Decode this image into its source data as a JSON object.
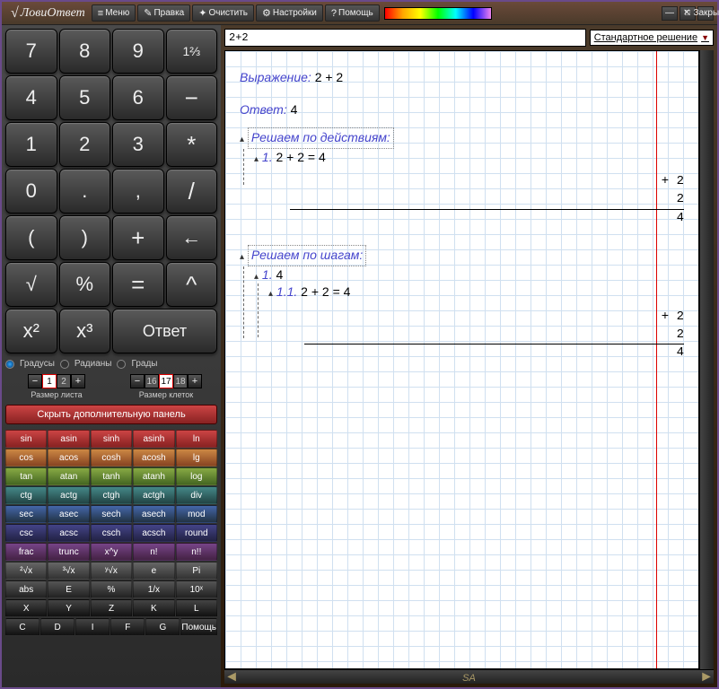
{
  "app": {
    "logo_text": "ЛовиОтвет"
  },
  "menu": {
    "items": [
      {
        "icon": "≡",
        "label": "Меню"
      },
      {
        "icon": "✎",
        "label": "Правка"
      },
      {
        "icon": "✦",
        "label": "Очистить"
      },
      {
        "icon": "⚙",
        "label": "Настройки"
      },
      {
        "icon": "?",
        "label": "Помощь"
      }
    ]
  },
  "window": {
    "close_label": "Закрыть"
  },
  "keypad": {
    "k7": "7",
    "k8": "8",
    "k9": "9",
    "kfrac": "1⅔",
    "k4": "4",
    "k5": "5",
    "k6": "6",
    "kminus": "−",
    "k1": "1",
    "k2": "2",
    "k3": "3",
    "kmul": "*",
    "k0": "0",
    "kdot": ".",
    "kcomma": ",",
    "kdiv": "/",
    "klp": "(",
    "krp": ")",
    "kplus": "+",
    "kdel": "←",
    "ksqrt": "√",
    "kpct": "%",
    "keq": "=",
    "kpow": "^",
    "kx2": "x²",
    "kx3": "x³",
    "kans": "Ответ"
  },
  "angles": {
    "deg": "Градусы",
    "rad": "Радианы",
    "grad": "Грады"
  },
  "sheet": {
    "sheet_vals": [
      "1",
      "2"
    ],
    "sheet_sel": 0,
    "sheet_label": "Размер листа",
    "cell_vals": [
      "16",
      "17",
      "18"
    ],
    "cell_sel": 1,
    "cell_label": "Размер клеток"
  },
  "hide_panel": "Скрыть дополнительную панель",
  "func": {
    "rows": [
      {
        "cls": "sin",
        "cells": [
          "sin",
          "asin",
          "sinh",
          "asinh",
          "ln"
        ]
      },
      {
        "cls": "cos",
        "cells": [
          "cos",
          "acos",
          "cosh",
          "acosh",
          "lg"
        ]
      },
      {
        "cls": "tan",
        "cells": [
          "tan",
          "atan",
          "tanh",
          "atanh",
          "log"
        ]
      },
      {
        "cls": "ctg",
        "cells": [
          "ctg",
          "actg",
          "ctgh",
          "actgh",
          "div"
        ]
      },
      {
        "cls": "sec",
        "cells": [
          "sec",
          "asec",
          "sech",
          "asech",
          "mod"
        ]
      },
      {
        "cls": "csc",
        "cells": [
          "csc",
          "acsc",
          "csch",
          "acsch",
          "round"
        ]
      },
      {
        "cls": "misc",
        "cells": [
          "frac",
          "trunc",
          "x^y",
          "n!",
          "n!!"
        ]
      },
      {
        "cls": "root",
        "cells": [
          "²√x",
          "³√x",
          "ʸ√x",
          "e",
          "Pi"
        ]
      },
      {
        "cls": "abs",
        "cells": [
          "abs",
          "E",
          "%",
          "1/x",
          "10ˣ"
        ]
      },
      {
        "cls": "var",
        "cells": [
          "X",
          "Y",
          "Z",
          "K",
          "L"
        ]
      }
    ],
    "bottom": [
      "C",
      "D",
      "I",
      "F",
      "G",
      "Помощь"
    ]
  },
  "expr": {
    "input": "2+2",
    "mode": "Стандартное решение"
  },
  "solution": {
    "expr_lbl": "Выражение:",
    "expr_val": "2 + 2",
    "ans_lbl": "Ответ:",
    "ans_val": "4",
    "by_actions": "Решаем по действиям:",
    "act1_num": "1.",
    "act1": "2 + 2 = 4",
    "col_plus": "+ 2",
    "col_mid": "2",
    "col_res": "4",
    "by_steps": "Решаем по шагам:",
    "st1_num": "1.",
    "st1": "4",
    "st11_num": "1.1.",
    "st11": "2 + 2 = 4"
  },
  "footer": {
    "brand": "SA"
  }
}
